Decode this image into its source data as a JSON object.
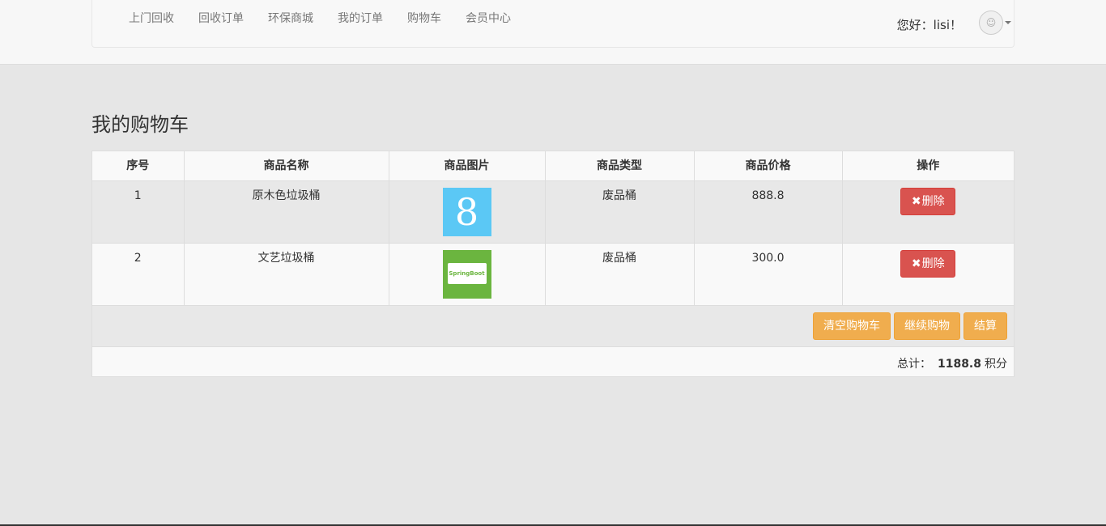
{
  "nav": {
    "links": [
      "上门回收",
      "回收订单",
      "环保商城",
      "我的订单",
      "购物车",
      "会员中心"
    ],
    "greeting": "您好：lisi！"
  },
  "page": {
    "title": "我的购物车"
  },
  "table": {
    "headers": [
      "序号",
      "商品名称",
      "商品图片",
      "商品类型",
      "商品价格",
      "操作"
    ],
    "rows": [
      {
        "index": "1",
        "name": "原木色垃圾桶",
        "image_text": "8",
        "type": "废品桶",
        "price": "888.8",
        "delete_label": "删除"
      },
      {
        "index": "2",
        "name": "文艺垃圾桶",
        "image_text": "SpringBoot",
        "type": "废品桶",
        "price": "300.0",
        "delete_label": "删除"
      }
    ]
  },
  "actions": {
    "clear_label": "清空购物车",
    "continue_label": "继续购物",
    "checkout_label": "结算"
  },
  "summary": {
    "total_label": "总计：",
    "total_value": "1188.8",
    "unit": "积分"
  },
  "colors": {
    "danger": "#d9534f",
    "warning": "#f0ad4e",
    "thumb_blue": "#5bc8f5",
    "thumb_green": "#6bb53f"
  },
  "icons": {
    "delete": "times-icon",
    "avatar": "avatar-icon"
  }
}
